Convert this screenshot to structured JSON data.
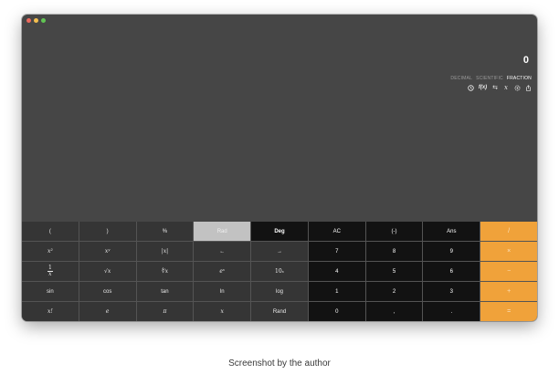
{
  "display": {
    "value": "0"
  },
  "modes": [
    {
      "label": "DECIMAL",
      "active": false
    },
    {
      "label": "SCIENTIFIC",
      "active": false
    },
    {
      "label": "FRACTION",
      "active": true
    }
  ],
  "tools": [
    {
      "icon": "history-icon"
    },
    {
      "icon": "function-icon",
      "label": "f(x)"
    },
    {
      "icon": "swap-icon",
      "label": "⇆"
    },
    {
      "icon": "variable-icon",
      "label": "x"
    },
    {
      "icon": "settings-icon"
    },
    {
      "icon": "share-icon"
    }
  ],
  "keys": {
    "open_paren": "(",
    "close_paren": ")",
    "percent": "%",
    "rad": "Rad",
    "deg": "Deg",
    "ac": "AC",
    "negate": "(-)",
    "ans": "Ans",
    "divide": "/",
    "x_squared": "x²",
    "x_pow_y": "xʸ",
    "abs": "|x|",
    "cursor_left": "←",
    "cursor_right": "→",
    "d7": "7",
    "d8": "8",
    "d9": "9",
    "multiply": "×",
    "reciprocal_num": "1",
    "reciprocal_den": "x",
    "sqrt": "√x",
    "nth_root": "∜x",
    "exp": "eˣ",
    "ten_pow_base": "10",
    "ten_pow_exp": "x",
    "d4": "4",
    "d5": "5",
    "d6": "6",
    "subtract": "−",
    "sin": "sin",
    "cos": "cos",
    "tan": "tan",
    "ln": "ln",
    "log": "log",
    "d1": "1",
    "d2": "2",
    "d3": "3",
    "add": "+",
    "factorial": "x!",
    "e": "e",
    "pi": "π",
    "variable_x": "x",
    "rand": "Rand",
    "d0": "0",
    "comma": ",",
    "decimal": ".",
    "equals": "="
  },
  "caption": "Screenshot by the author",
  "colors": {
    "window_bg": "#464646",
    "sci_key": "#353535",
    "num_key": "#121212",
    "op_key": "#f0a23a",
    "rad_key": "#c2c2c2"
  }
}
